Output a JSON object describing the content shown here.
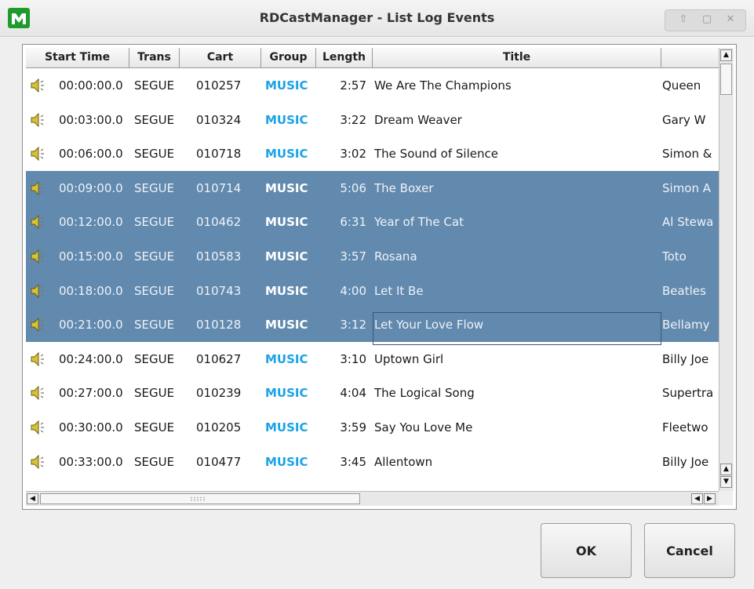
{
  "window": {
    "title": "RDCastManager - List Log Events",
    "controls": [
      "up-arrow-icon",
      "maximize-icon",
      "close-icon"
    ]
  },
  "columns": [
    "Start Time",
    "Trans",
    "Cart",
    "Group",
    "Length",
    "Title"
  ],
  "rows": [
    {
      "start": "00:00:00.0",
      "trans": "SEGUE",
      "cart": "010257",
      "group": "MUSIC",
      "length": "2:57",
      "title": "We Are The Champions",
      "artist": "Queen",
      "selected": false
    },
    {
      "start": "00:03:00.0",
      "trans": "SEGUE",
      "cart": "010324",
      "group": "MUSIC",
      "length": "3:22",
      "title": "Dream Weaver",
      "artist": "Gary W",
      "selected": false
    },
    {
      "start": "00:06:00.0",
      "trans": "SEGUE",
      "cart": "010718",
      "group": "MUSIC",
      "length": "3:02",
      "title": "The Sound of Silence",
      "artist": "Simon &",
      "selected": false
    },
    {
      "start": "00:09:00.0",
      "trans": "SEGUE",
      "cart": "010714",
      "group": "MUSIC",
      "length": "5:06",
      "title": "The Boxer",
      "artist": "Simon A",
      "selected": true
    },
    {
      "start": "00:12:00.0",
      "trans": "SEGUE",
      "cart": "010462",
      "group": "MUSIC",
      "length": "6:31",
      "title": "Year of The Cat",
      "artist": "Al Stewa",
      "selected": true
    },
    {
      "start": "00:15:00.0",
      "trans": "SEGUE",
      "cart": "010583",
      "group": "MUSIC",
      "length": "3:57",
      "title": "Rosana",
      "artist": "Toto",
      "selected": true
    },
    {
      "start": "00:18:00.0",
      "trans": "SEGUE",
      "cart": "010743",
      "group": "MUSIC",
      "length": "4:00",
      "title": "Let It Be",
      "artist": "Beatles",
      "selected": true
    },
    {
      "start": "00:21:00.0",
      "trans": "SEGUE",
      "cart": "010128",
      "group": "MUSIC",
      "length": "3:12",
      "title": "Let Your Love Flow",
      "artist": "Bellamy",
      "selected": true
    },
    {
      "start": "00:24:00.0",
      "trans": "SEGUE",
      "cart": "010627",
      "group": "MUSIC",
      "length": "3:10",
      "title": "Uptown Girl",
      "artist": "Billy Joe",
      "selected": false
    },
    {
      "start": "00:27:00.0",
      "trans": "SEGUE",
      "cart": "010239",
      "group": "MUSIC",
      "length": "4:04",
      "title": "The Logical Song",
      "artist": "Supertra",
      "selected": false
    },
    {
      "start": "00:30:00.0",
      "trans": "SEGUE",
      "cart": "010205",
      "group": "MUSIC",
      "length": "3:59",
      "title": "Say You Love Me",
      "artist": "Fleetwo",
      "selected": false
    },
    {
      "start": "00:33:00.0",
      "trans": "SEGUE",
      "cart": "010477",
      "group": "MUSIC",
      "length": "3:45",
      "title": "Allentown",
      "artist": "Billy Joe",
      "selected": false
    }
  ],
  "buttons": {
    "ok": "OK",
    "cancel": "Cancel"
  },
  "colors": {
    "selection": "#6289ae",
    "group_text": "#1aa3e6",
    "app_icon": "#1f9a2c"
  }
}
